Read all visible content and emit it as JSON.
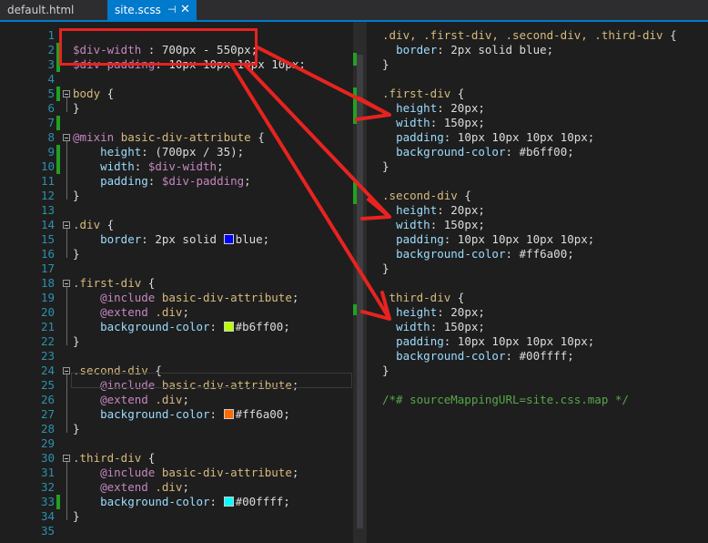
{
  "tabs": [
    {
      "label": "default.html",
      "active": false
    },
    {
      "label": "site.scss",
      "active": true,
      "pin": "⊣",
      "close": "✕"
    }
  ],
  "left_lines": [
    {
      "n": "1",
      "parts": []
    },
    {
      "n": "2",
      "parts": [
        [
          "var",
          "$div-width"
        ],
        [
          "plain",
          " : 700px - 550px;"
        ]
      ]
    },
    {
      "n": "3",
      "parts": [
        [
          "var",
          "$div-padding"
        ],
        [
          "plain",
          ": 10px 10px 10px 10px;"
        ]
      ]
    },
    {
      "n": "4",
      "parts": []
    },
    {
      "n": "5",
      "parts": [
        [
          "sel",
          "body"
        ],
        [
          "plain",
          " {"
        ]
      ]
    },
    {
      "n": "6",
      "parts": [
        [
          "plain",
          "}"
        ]
      ]
    },
    {
      "n": "7",
      "parts": []
    },
    {
      "n": "8",
      "parts": [
        [
          "kw",
          "@mixin"
        ],
        [
          "plain",
          " "
        ],
        [
          "sel",
          "basic-div-attribute"
        ],
        [
          "plain",
          " {"
        ]
      ]
    },
    {
      "n": "9",
      "parts": [
        [
          "plain",
          "    "
        ],
        [
          "prop",
          "height"
        ],
        [
          "plain",
          ": (700px / 35);"
        ]
      ]
    },
    {
      "n": "10",
      "parts": [
        [
          "plain",
          "    "
        ],
        [
          "prop",
          "width"
        ],
        [
          "plain",
          ": "
        ],
        [
          "var",
          "$div-width"
        ],
        [
          "plain",
          ";"
        ]
      ]
    },
    {
      "n": "11",
      "parts": [
        [
          "plain",
          "    "
        ],
        [
          "prop",
          "padding"
        ],
        [
          "plain",
          ": "
        ],
        [
          "var",
          "$div-padding"
        ],
        [
          "plain",
          ";"
        ]
      ]
    },
    {
      "n": "12",
      "parts": [
        [
          "plain",
          "}"
        ]
      ]
    },
    {
      "n": "13",
      "parts": []
    },
    {
      "n": "14",
      "parts": [
        [
          "sel",
          ".div"
        ],
        [
          "plain",
          " {"
        ]
      ]
    },
    {
      "n": "15",
      "parts": [
        [
          "plain",
          "    "
        ],
        [
          "prop",
          "border"
        ],
        [
          "plain",
          ": 2px solid "
        ],
        [
          "swatch",
          "#0000ff"
        ],
        [
          "plain",
          "blue;"
        ]
      ]
    },
    {
      "n": "16",
      "parts": [
        [
          "plain",
          "}"
        ]
      ]
    },
    {
      "n": "17",
      "parts": []
    },
    {
      "n": "18",
      "parts": [
        [
          "sel",
          ".first-div"
        ],
        [
          "plain",
          " {"
        ]
      ]
    },
    {
      "n": "19",
      "parts": [
        [
          "plain",
          "    "
        ],
        [
          "kw",
          "@include"
        ],
        [
          "plain",
          " "
        ],
        [
          "sel",
          "basic-div-attribute"
        ],
        [
          "plain",
          ";"
        ]
      ]
    },
    {
      "n": "20",
      "parts": [
        [
          "plain",
          "    "
        ],
        [
          "kw",
          "@extend"
        ],
        [
          "plain",
          " "
        ],
        [
          "sel",
          ".div"
        ],
        [
          "plain",
          ";"
        ]
      ]
    },
    {
      "n": "21",
      "parts": [
        [
          "plain",
          "    "
        ],
        [
          "prop",
          "background-color"
        ],
        [
          "plain",
          ": "
        ],
        [
          "swatch",
          "#b6ff00"
        ],
        [
          "plain",
          "#b6ff00;"
        ]
      ]
    },
    {
      "n": "22",
      "parts": [
        [
          "plain",
          "}"
        ]
      ]
    },
    {
      "n": "23",
      "parts": []
    },
    {
      "n": "24",
      "parts": [
        [
          "sel",
          ".second-div"
        ],
        [
          "plain",
          " {"
        ]
      ]
    },
    {
      "n": "25",
      "parts": [
        [
          "plain",
          "    "
        ],
        [
          "kw",
          "@include"
        ],
        [
          "plain",
          " "
        ],
        [
          "sel",
          "basic-div-attribute"
        ],
        [
          "plain",
          ";"
        ]
      ]
    },
    {
      "n": "26",
      "parts": [
        [
          "plain",
          "    "
        ],
        [
          "kw",
          "@extend"
        ],
        [
          "plain",
          " "
        ],
        [
          "sel",
          ".div"
        ],
        [
          "plain",
          ";"
        ]
      ]
    },
    {
      "n": "27",
      "parts": [
        [
          "plain",
          "    "
        ],
        [
          "prop",
          "background-color"
        ],
        [
          "plain",
          ": "
        ],
        [
          "swatch",
          "#ff6a00"
        ],
        [
          "plain",
          "#ff6a00;"
        ]
      ]
    },
    {
      "n": "28",
      "parts": [
        [
          "plain",
          "}"
        ]
      ]
    },
    {
      "n": "29",
      "parts": []
    },
    {
      "n": "30",
      "parts": [
        [
          "sel",
          ".third-div"
        ],
        [
          "plain",
          " {"
        ]
      ]
    },
    {
      "n": "31",
      "parts": [
        [
          "plain",
          "    "
        ],
        [
          "kw",
          "@include"
        ],
        [
          "plain",
          " "
        ],
        [
          "sel",
          "basic-div-attribute"
        ],
        [
          "plain",
          ";"
        ]
      ]
    },
    {
      "n": "32",
      "parts": [
        [
          "plain",
          "    "
        ],
        [
          "kw",
          "@extend"
        ],
        [
          "plain",
          " "
        ],
        [
          "sel",
          ".div"
        ],
        [
          "plain",
          ";"
        ]
      ]
    },
    {
      "n": "33",
      "parts": [
        [
          "plain",
          "    "
        ],
        [
          "prop",
          "background-color"
        ],
        [
          "plain",
          ": "
        ],
        [
          "swatch",
          "#00ffff"
        ],
        [
          "plain",
          "#00ffff;"
        ]
      ]
    },
    {
      "n": "34",
      "parts": [
        [
          "plain",
          "}"
        ]
      ]
    },
    {
      "n": "35",
      "parts": []
    }
  ],
  "right_lines": [
    [
      [
        "sel",
        ".div, .first-div, .second-div, .third-div"
      ],
      [
        "plain",
        " {"
      ]
    ],
    [
      [
        "plain",
        "  "
      ],
      [
        "prop",
        "border"
      ],
      [
        "plain",
        ": 2px solid blue;"
      ]
    ],
    [
      [
        "plain",
        "}"
      ]
    ],
    [],
    [
      [
        "sel",
        ".first-div"
      ],
      [
        "plain",
        " {"
      ]
    ],
    [
      [
        "plain",
        "  "
      ],
      [
        "prop",
        "height"
      ],
      [
        "plain",
        ": 20px;"
      ]
    ],
    [
      [
        "plain",
        "  "
      ],
      [
        "prop",
        "width"
      ],
      [
        "plain",
        ": 150px;"
      ]
    ],
    [
      [
        "plain",
        "  "
      ],
      [
        "prop",
        "padding"
      ],
      [
        "plain",
        ": 10px 10px 10px 10px;"
      ]
    ],
    [
      [
        "plain",
        "  "
      ],
      [
        "prop",
        "background-color"
      ],
      [
        "plain",
        ": #b6ff00;"
      ]
    ],
    [
      [
        "plain",
        "}"
      ]
    ],
    [],
    [
      [
        "sel",
        ".second-div"
      ],
      [
        "plain",
        " {"
      ]
    ],
    [
      [
        "plain",
        "  "
      ],
      [
        "prop",
        "height"
      ],
      [
        "plain",
        ": 20px;"
      ]
    ],
    [
      [
        "plain",
        "  "
      ],
      [
        "prop",
        "width"
      ],
      [
        "plain",
        ": 150px;"
      ]
    ],
    [
      [
        "plain",
        "  "
      ],
      [
        "prop",
        "padding"
      ],
      [
        "plain",
        ": 10px 10px 10px 10px;"
      ]
    ],
    [
      [
        "plain",
        "  "
      ],
      [
        "prop",
        "background-color"
      ],
      [
        "plain",
        ": #ff6a00;"
      ]
    ],
    [
      [
        "plain",
        "}"
      ]
    ],
    [],
    [
      [
        "sel",
        ".third-div"
      ],
      [
        "plain",
        " {"
      ]
    ],
    [
      [
        "plain",
        "  "
      ],
      [
        "prop",
        "height"
      ],
      [
        "plain",
        ": 20px;"
      ]
    ],
    [
      [
        "plain",
        "  "
      ],
      [
        "prop",
        "width"
      ],
      [
        "plain",
        ": 150px;"
      ]
    ],
    [
      [
        "plain",
        "  "
      ],
      [
        "prop",
        "padding"
      ],
      [
        "plain",
        ": 10px 10px 10px 10px;"
      ]
    ],
    [
      [
        "plain",
        "  "
      ],
      [
        "prop",
        "background-color"
      ],
      [
        "plain",
        ": #00ffff;"
      ]
    ],
    [
      [
        "plain",
        "}"
      ]
    ],
    [],
    [
      [
        "comment",
        "/*# sourceMappingURL=site.css.map */"
      ]
    ]
  ],
  "colors": {
    "accent": "#007acc",
    "annotation": "#e8231f",
    "change_marker": "#21a121"
  }
}
